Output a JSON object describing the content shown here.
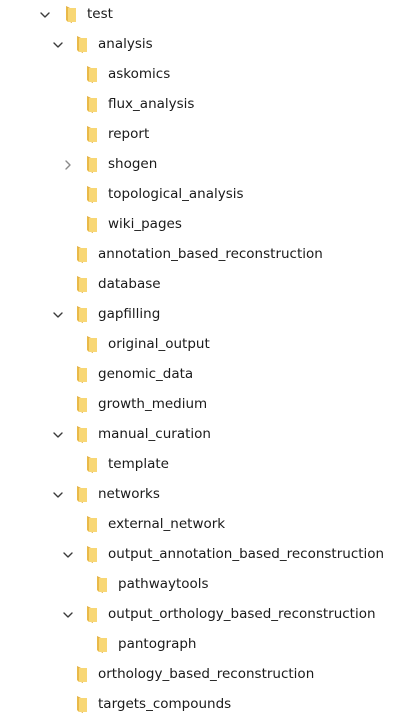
{
  "tree": [
    {
      "label": "test",
      "depth": 0,
      "chevron": "expanded"
    },
    {
      "label": "analysis",
      "depth": 1,
      "chevron": "expanded"
    },
    {
      "label": "askomics",
      "depth": 2,
      "chevron": "none"
    },
    {
      "label": "flux_analysis",
      "depth": 2,
      "chevron": "none"
    },
    {
      "label": "report",
      "depth": 2,
      "chevron": "none"
    },
    {
      "label": "shogen",
      "depth": 2,
      "chevron": "collapsed"
    },
    {
      "label": "topological_analysis",
      "depth": 2,
      "chevron": "none"
    },
    {
      "label": "wiki_pages",
      "depth": 2,
      "chevron": "none"
    },
    {
      "label": "annotation_based_reconstruction",
      "depth": 1,
      "chevron": "none"
    },
    {
      "label": "database",
      "depth": 1,
      "chevron": "none"
    },
    {
      "label": "gapfilling",
      "depth": 1,
      "chevron": "expanded"
    },
    {
      "label": "original_output",
      "depth": 2,
      "chevron": "none"
    },
    {
      "label": "genomic_data",
      "depth": 1,
      "chevron": "none"
    },
    {
      "label": "growth_medium",
      "depth": 1,
      "chevron": "none"
    },
    {
      "label": "manual_curation",
      "depth": 1,
      "chevron": "expanded"
    },
    {
      "label": "template",
      "depth": 2,
      "chevron": "none"
    },
    {
      "label": "networks",
      "depth": 1,
      "chevron": "expanded"
    },
    {
      "label": "external_network",
      "depth": 2,
      "chevron": "none"
    },
    {
      "label": "output_annotation_based_reconstruction",
      "depth": 2,
      "chevron": "expanded"
    },
    {
      "label": "pathwaytools",
      "depth": 3,
      "chevron": "none"
    },
    {
      "label": "output_orthology_based_reconstruction",
      "depth": 2,
      "chevron": "expanded"
    },
    {
      "label": "pantograph",
      "depth": 3,
      "chevron": "none"
    },
    {
      "label": "orthology_based_reconstruction",
      "depth": 1,
      "chevron": "none"
    },
    {
      "label": "targets_compounds",
      "depth": 1,
      "chevron": "none"
    }
  ],
  "colors": {
    "folder_back": "#E0A93A",
    "folder_front": "#F8D775",
    "folder_tab": "#E9B949",
    "chevron_expanded": "#3c3c3c",
    "chevron_collapsed": "#8a8a8a",
    "text": "#1a1a1a"
  }
}
